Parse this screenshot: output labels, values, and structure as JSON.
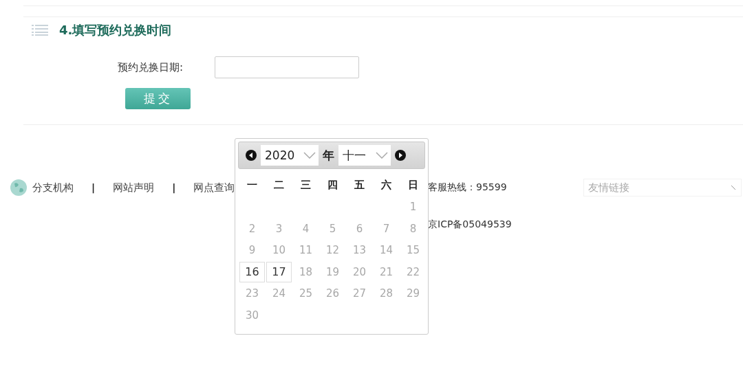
{
  "section": {
    "title": "4.填写预约兑换时间"
  },
  "form": {
    "label": "预约兑换日期:",
    "submit": "提交"
  },
  "footer": {
    "links": [
      "分支机构",
      "网站声明",
      "网点查询"
    ],
    "separator": "|",
    "hotline": "客服热线：95599",
    "icp": "京ICP备05049539",
    "friend_links": {
      "placeholder": "友情链接"
    }
  },
  "calendar": {
    "year": "2020",
    "year_suffix": "年",
    "month": "十一",
    "weekdays": [
      "一",
      "二",
      "三",
      "四",
      "五",
      "六",
      "日"
    ],
    "weeks": [
      [
        {
          "day": "1",
          "disabled": true
        }
      ],
      [
        {
          "day": "2",
          "disabled": true
        },
        {
          "day": "3",
          "disabled": true
        },
        {
          "day": "4",
          "disabled": true
        },
        {
          "day": "5",
          "disabled": true
        },
        {
          "day": "6",
          "disabled": true
        },
        {
          "day": "7",
          "disabled": true
        },
        {
          "day": "8",
          "disabled": true
        }
      ],
      [
        {
          "day": "9",
          "disabled": true
        },
        {
          "day": "10",
          "disabled": true
        },
        {
          "day": "11",
          "disabled": true
        },
        {
          "day": "12",
          "disabled": true
        },
        {
          "day": "13",
          "disabled": true
        },
        {
          "day": "14",
          "disabled": true
        },
        {
          "day": "15",
          "disabled": true
        }
      ],
      [
        {
          "day": "16",
          "disabled": false
        },
        {
          "day": "17",
          "disabled": false
        },
        {
          "day": "18",
          "disabled": true
        },
        {
          "day": "19",
          "disabled": true
        },
        {
          "day": "20",
          "disabled": true
        },
        {
          "day": "21",
          "disabled": true
        },
        {
          "day": "22",
          "disabled": true
        }
      ],
      [
        {
          "day": "23",
          "disabled": true
        },
        {
          "day": "24",
          "disabled": true
        },
        {
          "day": "25",
          "disabled": true
        },
        {
          "day": "26",
          "disabled": true
        },
        {
          "day": "27",
          "disabled": true
        },
        {
          "day": "28",
          "disabled": true
        },
        {
          "day": "29",
          "disabled": true
        }
      ],
      [
        {
          "day": "30",
          "disabled": true
        }
      ]
    ]
  }
}
